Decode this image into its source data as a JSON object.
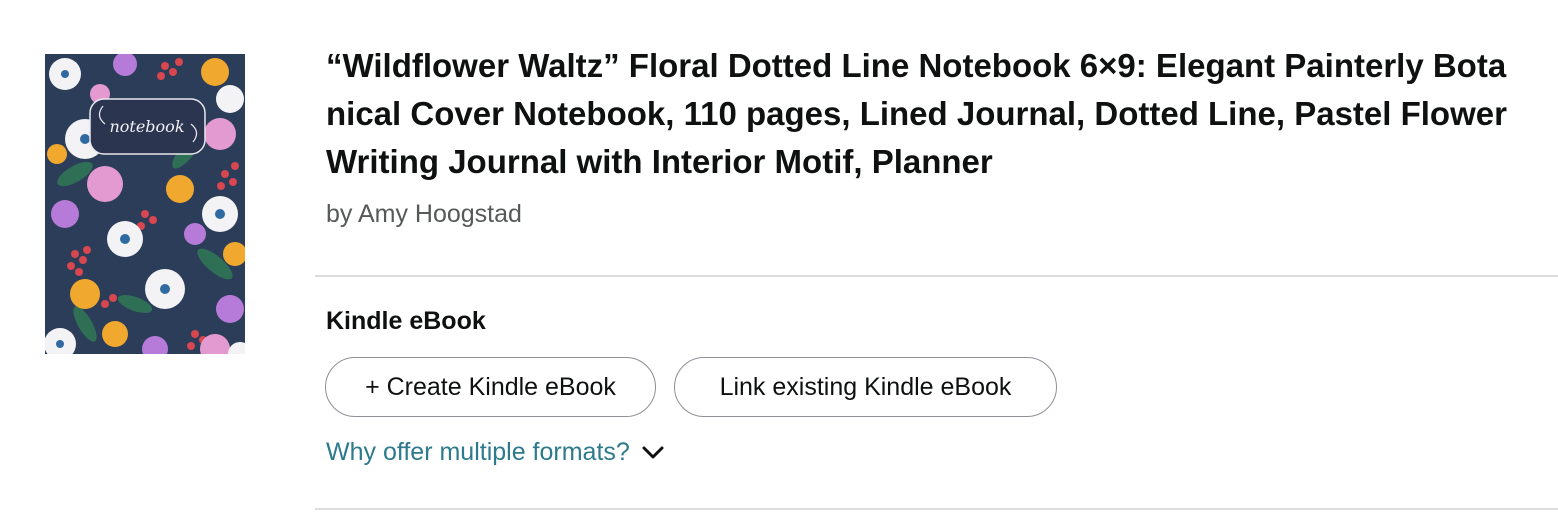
{
  "book": {
    "title": "“Wildflower Waltz” Floral Dotted Line Notebook 6×9: Elegant Painterly Botanical Cover Notebook, 110 pages, Lined Journal, Dotted Line, Pastel Flower Writing Journal with Interior Motif, Planner",
    "author": "by Amy Hoogstad",
    "cover_label": "notebook"
  },
  "formats": {
    "heading": "Kindle eBook",
    "create_button": "+ Create Kindle eBook",
    "link_button": "Link existing Kindle eBook",
    "why_link": "Why offer multiple formats?"
  },
  "icons": {
    "expand": "chevron-down-icon"
  },
  "colors": {
    "link": "#2c7a8c",
    "cover_label_bg": "#2c3550"
  }
}
